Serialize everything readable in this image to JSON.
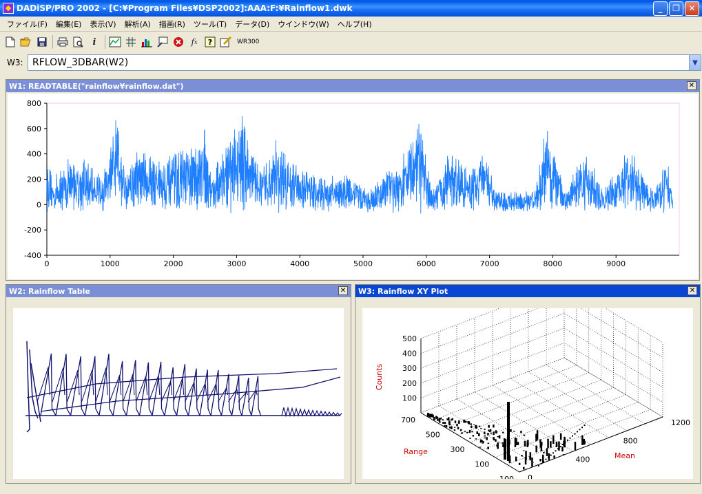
{
  "window": {
    "title": "DADiSP/PRO 2002 - [C:¥Program Files¥DSP2002]:AAA:F:¥Rainflow1.dwk",
    "minimize": "_",
    "maximize": "❐",
    "close": "✕"
  },
  "menu": [
    "ファイル(F)",
    "編集(E)",
    "表示(V)",
    "解析(A)",
    "描画(R)",
    "ツール(T)",
    "データ(D)",
    "ウインドウ(W)",
    "ヘルプ(H)"
  ],
  "toolbar": {
    "wr_label": "WR300"
  },
  "command": {
    "label": "W3:",
    "value": "RFLOW_3DBAR(W2)"
  },
  "w1": {
    "title": "W1: READTABLE(\"rainflow¥rainflow.dat\")",
    "close": "✕",
    "chart_data": {
      "type": "line",
      "color": "#1f7fff",
      "xlim": [
        0,
        10000
      ],
      "ylim": [
        -400,
        800
      ],
      "xticks": [
        "0",
        "1000",
        "2000",
        "3000",
        "4000",
        "5000",
        "6000",
        "7000",
        "8000",
        "9000"
      ],
      "yticks": [
        "800",
        "600",
        "400",
        "200",
        "0",
        "-200",
        "-400"
      ],
      "peaks_x": [
        0,
        100,
        400,
        900,
        1100,
        1200,
        1500,
        1900,
        2100,
        2350,
        2500,
        2600,
        3100,
        3400,
        3600,
        3900,
        4400,
        4800,
        5100,
        5700,
        5900,
        6100,
        6400,
        6700,
        6900,
        7100,
        7500,
        7700,
        7900,
        8200,
        8500,
        8800,
        9200,
        9600,
        9800,
        9900
      ],
      "peaks_y": [
        300,
        150,
        350,
        200,
        660,
        300,
        420,
        300,
        380,
        400,
        600,
        200,
        700,
        200,
        450,
        300,
        150,
        200,
        50,
        400,
        600,
        50,
        400,
        200,
        420,
        50,
        50,
        50,
        600,
        50,
        400,
        50,
        400,
        50,
        350,
        0
      ]
    }
  },
  "w2": {
    "title": "W2: Rainflow Table",
    "close": "✕",
    "chart_data": {
      "type": "line",
      "color": "#12126e",
      "note_series": "cycle traces"
    }
  },
  "w3": {
    "title": "W3: Rainflow XY Plot",
    "close": "✕",
    "chart_data": {
      "type": "bar",
      "zlabel": "Counts",
      "xlabel": "Range",
      "ylabel": "Mean",
      "zticks": [
        "500",
        "400",
        "300",
        "200",
        "100"
      ],
      "range_ticks": [
        "700",
        "500",
        "300",
        "100",
        "-100"
      ],
      "mean_ticks": [
        "0",
        "400",
        "800",
        "1200"
      ],
      "label_color": "#cc0000"
    }
  }
}
